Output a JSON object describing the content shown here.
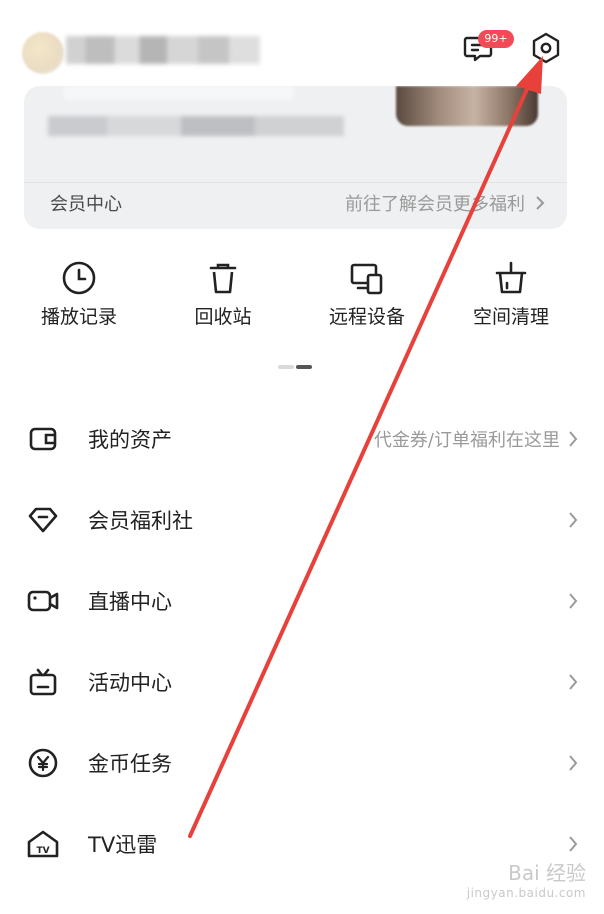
{
  "header": {
    "message_badge": "99+",
    "message_icon": "message-icon",
    "settings_icon": "settings-icon"
  },
  "member_card": {
    "label": "会员中心",
    "link_text": "前往了解会员更多福利"
  },
  "quick_actions": [
    {
      "label": "播放记录",
      "icon": "clock-icon"
    },
    {
      "label": "回收站",
      "icon": "trash-icon"
    },
    {
      "label": "远程设备",
      "icon": "devices-icon"
    },
    {
      "label": "空间清理",
      "icon": "cleanup-icon"
    }
  ],
  "menu": [
    {
      "title": "我的资产",
      "hint": "代金券/订单福利在这里",
      "icon": "wallet-icon"
    },
    {
      "title": "会员福利社",
      "hint": "",
      "icon": "diamond-icon"
    },
    {
      "title": "直播中心",
      "hint": "",
      "icon": "video-camera-icon"
    },
    {
      "title": "活动中心",
      "hint": "",
      "icon": "tv-box-icon"
    },
    {
      "title": "金币任务",
      "hint": "",
      "icon": "coin-icon"
    },
    {
      "title": "TV迅雷",
      "hint": "",
      "icon": "tv-house-icon"
    }
  ],
  "colors": {
    "badge": "#f24b57",
    "annotation_arrow": "#e8403a",
    "card_bg": "#eef0f2"
  },
  "watermark": {
    "main": "Bai 经验",
    "sub": "jingyan.baidu.com"
  }
}
